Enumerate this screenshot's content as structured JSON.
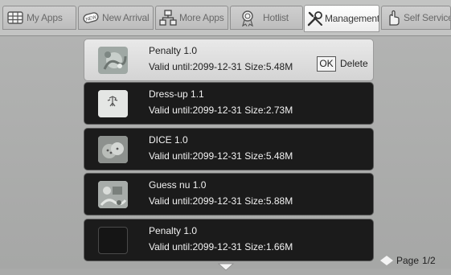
{
  "tabs": [
    {
      "label": "My Apps",
      "icon": "grid-icon"
    },
    {
      "label": "New Arrival",
      "icon": "new-badge-icon"
    },
    {
      "label": "More Apps",
      "icon": "network-icon"
    },
    {
      "label": "Hotlist",
      "icon": "award-icon"
    },
    {
      "label": "Management",
      "icon": "tools-icon",
      "active": true
    },
    {
      "label": "Self Service",
      "icon": "hand-icon"
    }
  ],
  "apps": [
    {
      "name": "Penalty  1.0",
      "details": "Valid until:2099-12-31 Size:5.48M",
      "selected": true
    },
    {
      "name": "Dress-up  1.1",
      "details": "Valid until:2099-12-31 Size:2.73M"
    },
    {
      "name": "DICE  1.0",
      "details": "Valid until:2099-12-31 Size:5.48M"
    },
    {
      "name": "Guess nu  1.0",
      "details": "Valid until:2099-12-31 Size:5.88M"
    },
    {
      "name": "Penalty  1.0",
      "details": "Valid until:2099-12-31 Size:1.66M"
    }
  ],
  "actions": {
    "ok": "OK",
    "delete": "Delete"
  },
  "pager": {
    "label": "Page",
    "value": "1/2"
  }
}
